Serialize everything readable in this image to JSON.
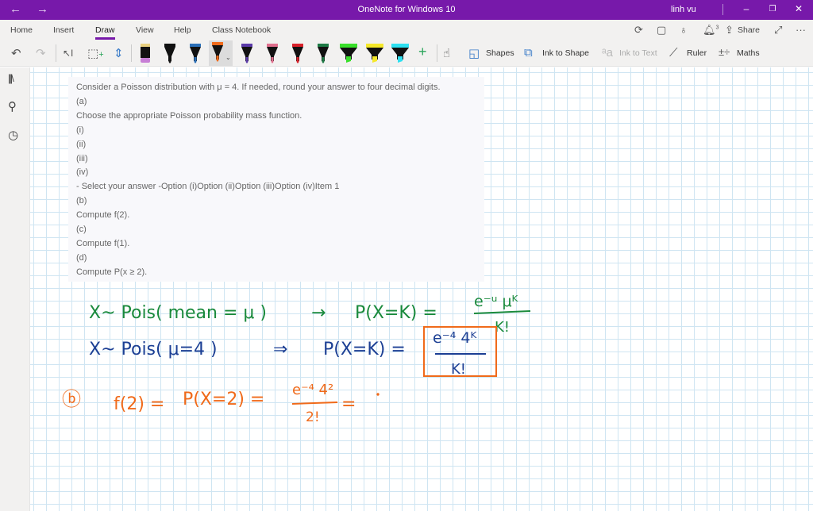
{
  "titlebar": {
    "back_icon": "arrow-left-icon",
    "forward_icon": "arrow-right-icon",
    "title": "OneNote for Windows 10",
    "user": "linh vu",
    "minimize": "–",
    "restore": "❐",
    "close": "✕"
  },
  "tabs": [
    {
      "label": "Home"
    },
    {
      "label": "Insert"
    },
    {
      "label": "Draw",
      "active": true
    },
    {
      "label": "View"
    },
    {
      "label": "Help"
    },
    {
      "label": "Class Notebook"
    }
  ],
  "tab_actions": {
    "sync_icon": "sync-icon",
    "notebook_icon": "sticky-notes-icon",
    "tell_me_icon": "lightbulb-icon",
    "notifications_icon": "bell-icon",
    "notifications_count": "3",
    "share_label": "Share",
    "expand_icon": "expand-icon",
    "more_icon": "more-icon"
  },
  "toolbar": {
    "undo_icon": "undo-icon",
    "redo_icon": "redo-icon",
    "type_select_icon": "type-select-icon",
    "lasso_icon": "lasso-select-icon",
    "add_space_icon": "add-space-icon",
    "pens": [
      {
        "name": "eraser",
        "color": "#c77fd6"
      },
      {
        "name": "pen-black",
        "color": "#111111"
      },
      {
        "name": "pen-blue",
        "color": "#2a6fb8"
      },
      {
        "name": "pen-orange",
        "color": "#f06a1a",
        "selected": true
      },
      {
        "name": "pen-purple",
        "color": "#5b3aa8"
      },
      {
        "name": "pen-pink",
        "color": "#e0708e"
      },
      {
        "name": "pen-red",
        "color": "#d8212a"
      },
      {
        "name": "pen-green",
        "color": "#1e7a45"
      },
      {
        "name": "highlighter-green",
        "color": "#39e02a"
      },
      {
        "name": "highlighter-yellow",
        "color": "#f5e82a"
      },
      {
        "name": "highlighter-cyan",
        "color": "#2ee0f0"
      }
    ],
    "add_pen": "+",
    "touch_draw_icon": "touch-draw-icon",
    "shapes_label": "Shapes",
    "ink_to_shape_label": "Ink to Shape",
    "ink_to_text_label": "Ink to Text",
    "ruler_label": "Ruler",
    "maths_label": "Maths"
  },
  "sidebar": {
    "notebooks_icon": "notebooks-icon",
    "search_icon": "search-icon",
    "recent_icon": "clock-icon"
  },
  "question": {
    "lines": [
      "Consider a Poisson distribution with μ = 4. If needed, round your answer to four decimal digits.",
      "(a)",
      "Choose the appropriate Poisson probability mass function.",
      "(i)",
      "(ii)",
      "(iii)",
      "(iv)",
      "- Select your answer -Option (i)Option (ii)Option (iii)Option (iv)Item 1",
      "(b)",
      "Compute f(2).",
      "(c)",
      "Compute f(1).",
      "(d)",
      "Compute P(x ≥ 2)."
    ]
  },
  "ink": {
    "colors": {
      "green": "#1a8a3c",
      "blue": "#1c3f94",
      "orange": "#f06a1a"
    },
    "line1": {
      "lhs": "X~ Pois( mean = μ )",
      "arrow": "→",
      "pmf": "P(X=K) =",
      "numerator": "e⁻ᵘ μᴷ",
      "denominator": "K!"
    },
    "line2": {
      "lhs": "X~ Pois( μ=4 )",
      "arrow": "⇒",
      "pmf": "P(X=K) =",
      "numerator": "e⁻⁴ 4ᴷ",
      "denominator": "K!"
    },
    "line3": {
      "label": "ⓑ",
      "lhs": "f(2) =",
      "pmf": "P(X=2) =",
      "numerator": "e⁻⁴ 4²",
      "denominator": "2!",
      "trailing": "="
    }
  }
}
